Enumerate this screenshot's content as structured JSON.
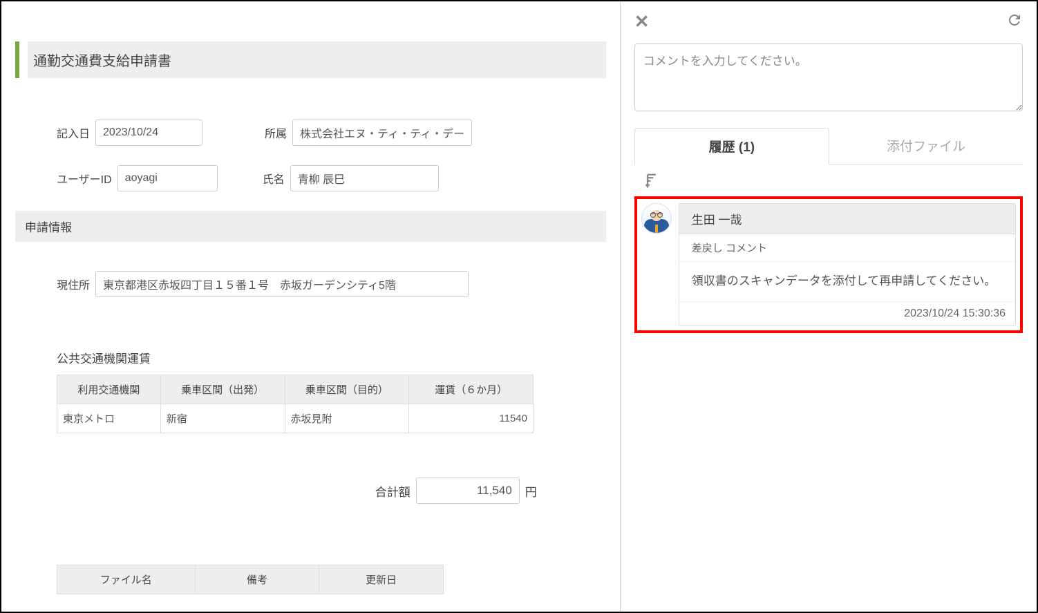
{
  "form": {
    "title": "通勤交通費支給申請書",
    "date_label": "記入日",
    "date_value": "2023/10/24",
    "org_label": "所属",
    "org_value": "株式会社エヌ・ティ・ティ・データ",
    "userid_label": "ユーザーID",
    "userid_value": "aoyagi",
    "name_label": "氏名",
    "name_value": "青柳 辰巳",
    "section_header": "申請情報",
    "addr_label": "現住所",
    "addr_value": "東京都港区赤坂四丁目１５番１号　赤坂ガーデンシティ5階",
    "fare_heading": "公共交通機関運賃",
    "fare_columns": {
      "c1": "利用交通機関",
      "c2": "乗車区間（出発）",
      "c3": "乗車区間（目的）",
      "c4": "運賃（６か月）"
    },
    "fare_rows": [
      {
        "transport": "東京メトロ",
        "from": "新宿",
        "to": "赤坂見附",
        "fare": "11540"
      }
    ],
    "total_label": "合計額",
    "total_value": "11,540",
    "total_unit": "円",
    "attach_columns": {
      "c1": "ファイル名",
      "c2": "備考",
      "c3": "更新日"
    }
  },
  "side": {
    "comment_placeholder": "コメントを入力してください。",
    "tabs": {
      "history": "履歴 (1)",
      "attachments": "添付ファイル"
    },
    "history": [
      {
        "user": "生田 一哉",
        "type": "差戻し コメント",
        "comment": "領収書のスキャンデータを添付して再申請してください。",
        "timestamp": "2023/10/24 15:30:36"
      }
    ]
  }
}
